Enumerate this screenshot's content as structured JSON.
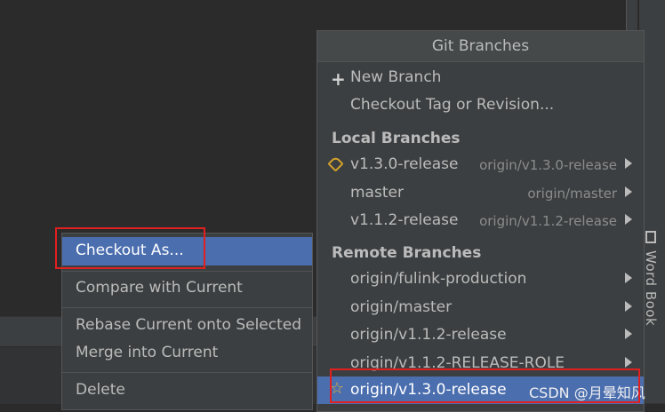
{
  "popup": {
    "title": "Git Branches",
    "actions": [
      "New Branch",
      "Checkout Tag or Revision..."
    ],
    "local_header": "Local Branches",
    "local": [
      {
        "name": "v1.3.0-release",
        "tracking": "origin/v1.3.0-release",
        "icon": "tag-icon"
      },
      {
        "name": "master",
        "tracking": "origin/master"
      },
      {
        "name": "v1.1.2-release",
        "tracking": "origin/v1.1.2-release"
      }
    ],
    "remote_header": "Remote Branches",
    "remote": [
      {
        "name": "origin/fulink-production"
      },
      {
        "name": "origin/master"
      },
      {
        "name": "origin/v1.1.2-release"
      },
      {
        "name": "origin/v1.1.2-RELEASE-ROLE"
      },
      {
        "name": "origin/v1.3.0-release",
        "selected": true,
        "icon": "star-icon"
      }
    ]
  },
  "context_menu": {
    "items": [
      "Checkout As...",
      "Compare with Current",
      "Rebase Current onto Selected",
      "Merge into Current",
      "Delete"
    ]
  },
  "sidebar": {
    "word_book": "Word Book"
  },
  "watermark": "CSDN @月晕知风",
  "colors": {
    "selection": "#4b6eaf",
    "highlight_box": "#e02020",
    "popup_bg": "#3c3f41",
    "editor_bg": "#2b2b2b"
  }
}
